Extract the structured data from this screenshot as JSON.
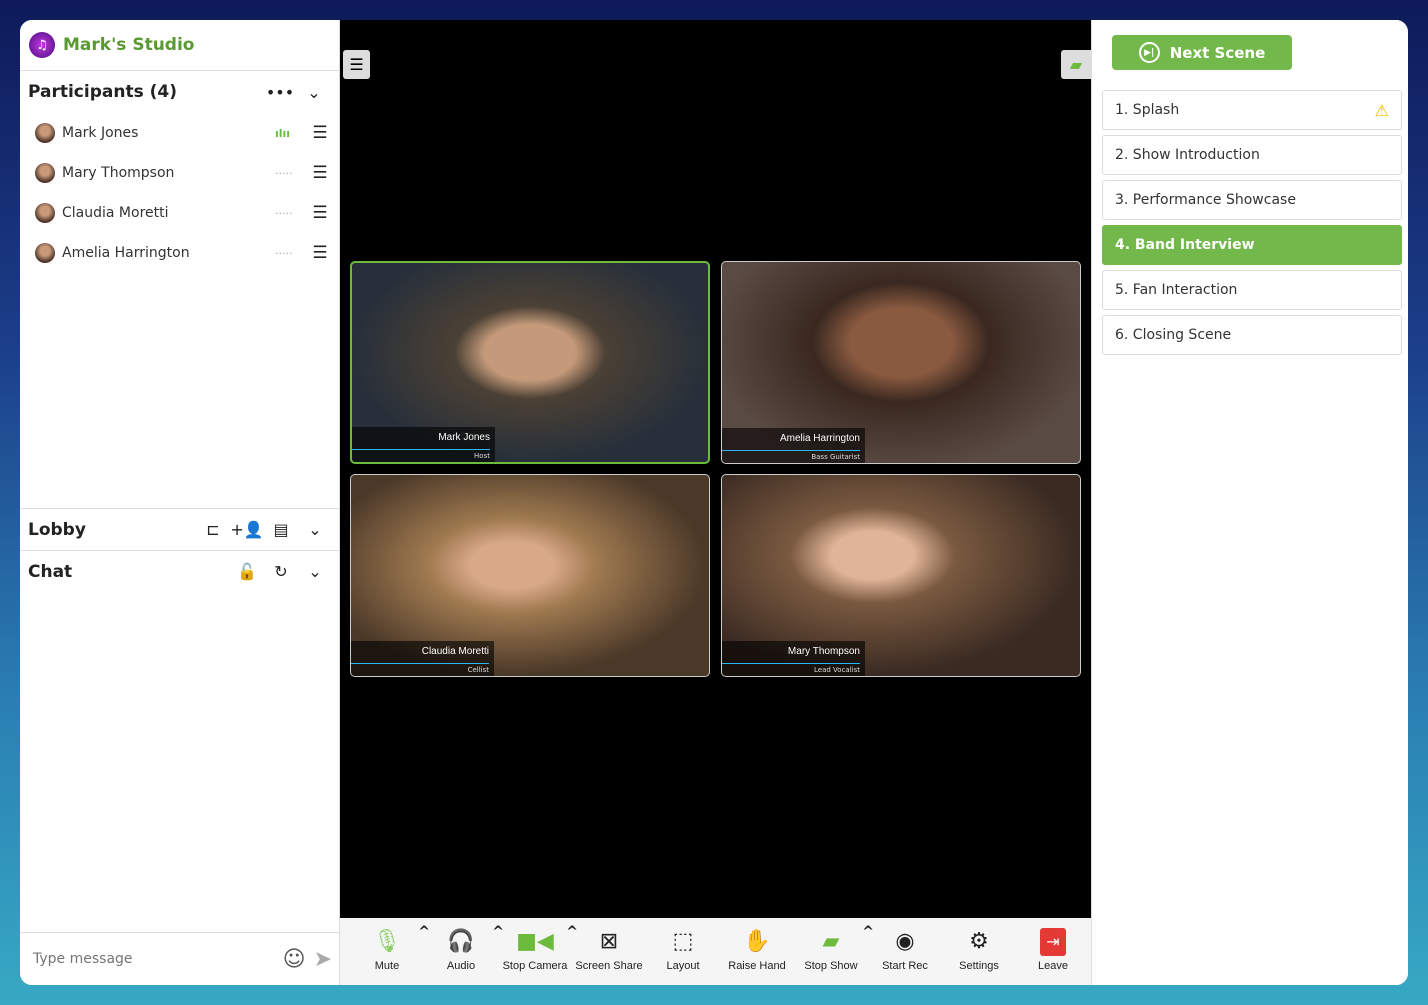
{
  "app": {
    "title": "Mark's Studio",
    "logo_icon": "music-note-icon"
  },
  "participants": {
    "title": "Participants (4)",
    "items": [
      {
        "name": "Mark Jones",
        "speaking": true
      },
      {
        "name": "Mary Thompson",
        "speaking": false
      },
      {
        "name": "Claudia Moretti",
        "speaking": false
      },
      {
        "name": "Amelia Harrington",
        "speaking": false
      }
    ]
  },
  "lobby": {
    "title": "Lobby"
  },
  "chat": {
    "title": "Chat",
    "placeholder": "Type message"
  },
  "videos": [
    {
      "name": "Mark Jones",
      "role": "Host",
      "active": true
    },
    {
      "name": "Amelia Harrington",
      "role": "Bass Guitarist",
      "active": false
    },
    {
      "name": "Claudia Moretti",
      "role": "Cellist",
      "active": false
    },
    {
      "name": "Mary Thompson",
      "role": "Lead Vocalist",
      "active": false
    }
  ],
  "toolbar": {
    "mute": "Mute",
    "audio": "Audio",
    "stop_camera": "Stop Camera",
    "screen_share": "Screen Share",
    "layout": "Layout",
    "raise_hand": "Raise Hand",
    "stop_show": "Stop Show",
    "start_rec": "Start Rec",
    "settings": "Settings",
    "leave": "Leave"
  },
  "scenes": {
    "next_label": "Next Scene",
    "active_index": 3,
    "items": [
      "1. Splash",
      "2. Show Introduction",
      "3. Performance Showcase",
      "4. Band Interview",
      "5. Fan Interaction",
      "6. Closing Scene"
    ]
  },
  "colors": {
    "accent": "#72b84a",
    "brand": "#5a9a34",
    "leave": "#e53935",
    "name_underline": "#29b6f6"
  }
}
